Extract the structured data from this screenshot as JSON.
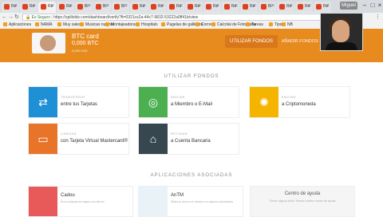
{
  "browser": {
    "tabs": [
      {
        "label": "Re"
      },
      {
        "label": "Re"
      },
      {
        "label": "Re"
      },
      {
        "label": "Re"
      },
      {
        "label": "Bi"
      },
      {
        "label": "Bi"
      },
      {
        "label": "Bi"
      },
      {
        "label": "Re"
      },
      {
        "label": "Re"
      },
      {
        "label": "Re"
      },
      {
        "label": "Re"
      },
      {
        "label": "Re"
      },
      {
        "label": "Re"
      },
      {
        "label": "Re"
      },
      {
        "label": "Bi"
      },
      {
        "label": "Re"
      },
      {
        "label": "Re"
      },
      {
        "label": "Re"
      }
    ],
    "user_chip": "Miguel",
    "address_prefix": "Es Seguro",
    "url": "https://spillolds.com/dashboard/verify?ft=0321cs2a-44c7-9832-53222a0ff41b/view",
    "bookmarks": [
      "Aplicaciones",
      "NAMA",
      "Muy sales",
      "Musicas nuevas",
      "Montajeadoras",
      "Hospitals",
      "Pagelas de gallinera",
      "Correo",
      "Calcolai de Fotografia",
      "Tareas",
      "Tips",
      "NB"
    ]
  },
  "header": {
    "card_name": "BTC card",
    "balance": "0,000 BTC",
    "balance_sub": "0,000 USD",
    "primary_button": "UTILIZAR FONDOS",
    "secondary_link": "AÑADIR FONDOS"
  },
  "use_funds": {
    "title": "UTILIZAR FONDOS",
    "tiles": [
      {
        "kicker": "TRANSFERIR",
        "label": "entre tus Tarjetas",
        "color": "#1f8fd6",
        "icon": "transfer-icon"
      },
      {
        "kicker": "ENVIAR",
        "label": "a Miembro o E-Mail",
        "color": "#4caf50",
        "icon": "user-send-icon"
      },
      {
        "kicker": "ENVIAR",
        "label": "a Criptomoneda",
        "color": "#f5b400",
        "icon": "crypto-icon"
      },
      {
        "kicker": "CARGAR",
        "label": "con Tarjeta Virtual Mastercard®",
        "color": "#e8742a",
        "icon": "virtual-card-icon"
      },
      {
        "kicker": "RETIRAR",
        "label": "a Cuenta Bancaria",
        "color": "#37474f",
        "icon": "bank-icon"
      }
    ]
  },
  "apps": {
    "title": "APLICACIONES ASOCIADAS",
    "items": [
      {
        "name": "Cadou",
        "desc": "Envía tarjetas de regalo con bitcoin",
        "color": "#e85a5a"
      },
      {
        "name": "AnTM",
        "desc": "Retira tu dinero en efectivo en cajeros autorizados",
        "color": "#e9f3f7"
      }
    ],
    "help_title": "Centro de ayuda",
    "help_desc": "Tienes alguna duda? Revisa nuestro centro de ayuda"
  }
}
